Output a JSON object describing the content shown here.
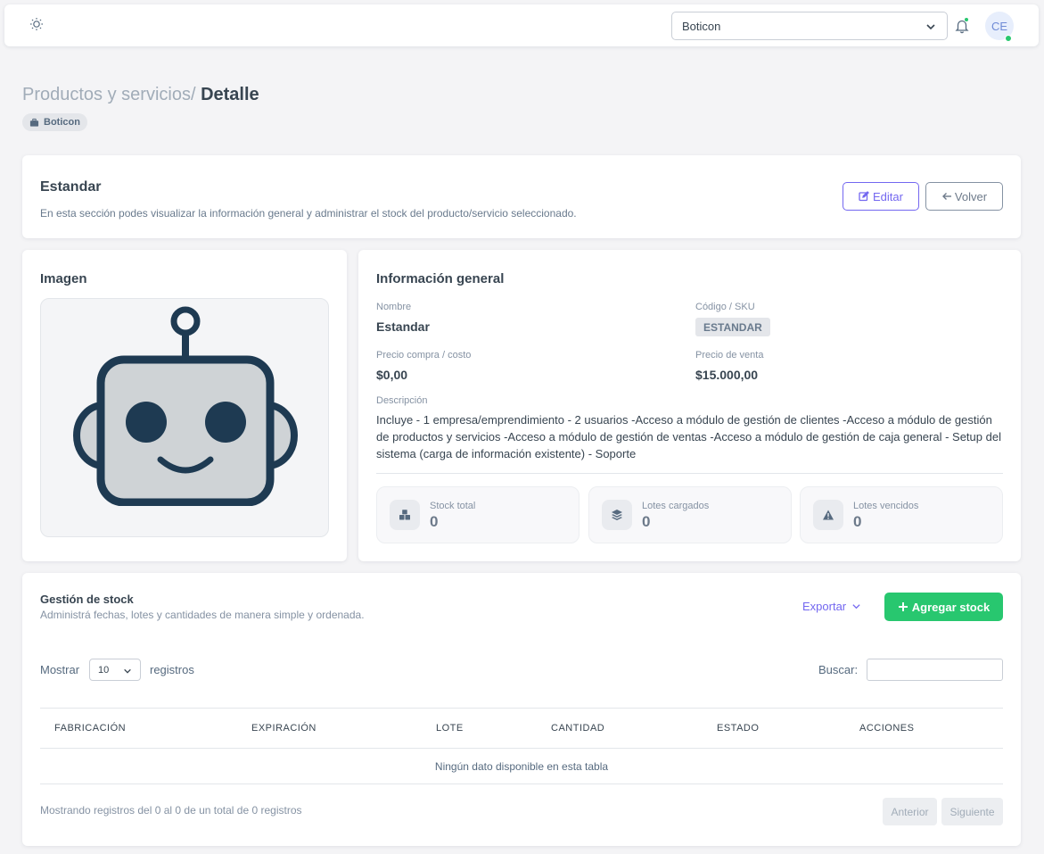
{
  "navbar": {
    "company_value": "Boticon",
    "avatar_initials": "CE"
  },
  "header": {
    "breadcrumb_parent": "Productos y servicios/",
    "breadcrumb_current": "Detalle",
    "company_badge": "Boticon"
  },
  "intro": {
    "title": "Estandar",
    "description": "En esta sección podes visualizar la información general y administrar el stock del producto/servicio seleccionado.",
    "edit_label": "Editar",
    "back_label": "Volver"
  },
  "image_card": {
    "title": "Imagen"
  },
  "info": {
    "title": "Información general",
    "name_label": "Nombre",
    "name_value": "Estandar",
    "sku_label": "Código / SKU",
    "sku_value": "ESTANDAR",
    "cost_label": "Precio compra / costo",
    "cost_value": "$0,00",
    "price_label": "Precio de venta",
    "price_value": "$15.000,00",
    "desc_label": "Descripción",
    "desc_value": "Incluye - 1 empresa/emprendimiento - 2 usuarios -Acceso a módulo de gestión de clientes -Acceso a módulo de gestión de productos y servicios -Acceso a módulo de gestión de ventas -Acceso a módulo de gestión de caja general - Setup del sistema (carga de información existente) - Soporte",
    "stats": [
      {
        "label": "Stock total",
        "value": "0",
        "icon": "boxes-icon"
      },
      {
        "label": "Lotes cargados",
        "value": "0",
        "icon": "layers-icon"
      },
      {
        "label": "Lotes vencidos",
        "value": "0",
        "icon": "warning-icon"
      }
    ]
  },
  "stock": {
    "title": "Gestión de stock",
    "subtitle": "Administrá fechas, lotes y cantidades de manera simple y ordenada.",
    "export_label": "Exportar",
    "add_label": "Agregar stock",
    "show_label": "Mostrar",
    "page_length": "10",
    "records_label": "registros",
    "search_label": "Buscar:",
    "columns": [
      "FABRICACIÓN",
      "EXPIRACIÓN",
      "LOTE",
      "CANTIDAD",
      "ESTADO",
      "ACCIONES"
    ],
    "empty_text": "Ningún dato disponible en esta tabla",
    "info_text": "Mostrando registros del 0 al 0 de un total de 0 registros",
    "prev_label": "Anterior",
    "next_label": "Siguiente"
  },
  "colors": {
    "primary": "#7367f0",
    "success": "#28c76f",
    "robot_face": "#cfd3d6",
    "robot_outline": "#1e3a52"
  }
}
